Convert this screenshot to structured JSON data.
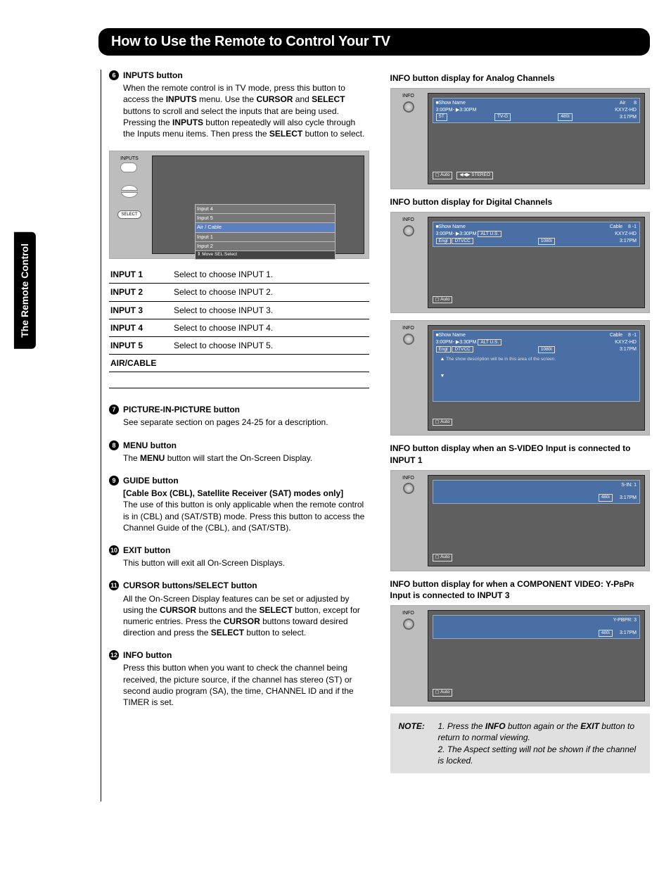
{
  "sideTab": "The Remote Control",
  "pageTitle": "How to Use the Remote to Control Your TV",
  "s6": {
    "num": "6",
    "head": "INPUTS button",
    "p1a": "When the remote control is in TV mode, press this button to access the ",
    "p1b": "INPUTS",
    "p1c": " menu. Use the ",
    "p1d": "CURSOR",
    "p1e": " and ",
    "p1f": "SELECT",
    "p1g": " buttons to scroll and select the inputs that are being used. Pressing the ",
    "p1h": "INPUTS",
    "p1i": " button repeatedly will also cycle through the Inputs menu items. Then press the ",
    "p1j": "SELECT",
    "p1k": " button to select."
  },
  "osd": {
    "inputsLbl": "INPUTS",
    "selectLbl": "SELECT",
    "items": [
      "Input 4",
      "Input 5",
      "Air / Cable",
      "Input 1",
      "Input 2"
    ],
    "footer": "⇕ Move    SEL:Select"
  },
  "inputTable": [
    [
      "INPUT 1",
      "Select to choose INPUT 1."
    ],
    [
      "INPUT 2",
      "Select to choose INPUT 2."
    ],
    [
      "INPUT 3",
      "Select to choose INPUT 3."
    ],
    [
      "INPUT 4",
      "Select to choose INPUT 4."
    ],
    [
      "INPUT 5",
      "Select to choose INPUT 5."
    ],
    [
      "AIR/CABLE",
      ""
    ]
  ],
  "s7": {
    "num": "7",
    "head": "PICTURE-IN-PICTURE button",
    "body": "See separate section on pages 24-25 for a description."
  },
  "s8": {
    "num": "8",
    "head": "MENU button",
    "b1a": "The ",
    "b1b": "MENU",
    "b1c": " button will start the On-Screen Display."
  },
  "s9": {
    "num": "9",
    "head": "GUIDE button",
    "sub": "[Cable Box (CBL), Satellite Receiver (SAT) modes only]",
    "body": "The use of this button is only applicable when the remote control is in (CBL) and (SAT/STB) mode. Press this button to access the Channel Guide of the (CBL), and (SAT/STB)."
  },
  "s10": {
    "num": "10",
    "head": "EXIT button",
    "body": "This button will exit all On-Screen Displays."
  },
  "s11": {
    "num": "11",
    "head": "CURSOR buttons/SELECT button",
    "b1a": "All the On-Screen Display features can be set or adjusted by using the ",
    "b1b": "CURSOR",
    "b1c": " buttons and the ",
    "b1d": "SELECT",
    "b1e": " button, except for numeric entries. Press the ",
    "b1f": "CURSOR",
    "b1g": " buttons toward desired direction and press the ",
    "b1h": "SELECT",
    "b1i": " button to select."
  },
  "s12": {
    "num": "12",
    "head": "INFO button",
    "body": "Press this button when you want to check the channel being received, the picture source, if the channel has stereo (ST) or second audio program (SA), the time, CHANNEL ID and if the TIMER is set."
  },
  "rh1": "INFO button display for Analog Channels",
  "analog": {
    "info": "INFO",
    "show": "■Show Name",
    "src": "Air",
    "ch": "8",
    "time": "3:00PM- ▶3:30PM",
    "call": "KXYZ-HD",
    "st": "ST",
    "rating": "TV-G",
    "res": "480i",
    "clk": "3:17PM",
    "auto": "▢ Auto",
    "stereo": "◀◀▶ STEREO"
  },
  "rh2": "INFO button display for Digital Channels",
  "dig1": {
    "info": "INFO",
    "show": "■Show Name",
    "src": "Cable",
    "ch": "8 -1",
    "time": "3:00PM- ▶3:30PM",
    "alt": "ALT U.S.",
    "call": "KXYZ-HD",
    "engl": "Engl",
    "dtvcc": "DTVCC",
    "res": "1080i",
    "clk": "3:17PM",
    "auto": "▢ Auto"
  },
  "dig2": {
    "info": "INFO",
    "show": "■Show Name",
    "src": "Cable",
    "ch": "8 -1",
    "time": "3:00PM- ▶3:30PM",
    "alt": "ALT U.S.",
    "call": "KXYZ-HD",
    "engl": "Engl",
    "dtvcc": "DTVCC",
    "res": "1080i",
    "clk": "3:17PM",
    "desc": "The show description will be in this area of the screen.",
    "up": "▲",
    "dn": "▼",
    "auto": "▢ Auto"
  },
  "rh3": "INFO button display when an S-VIDEO Input is connected to INPUT 1",
  "svid": {
    "info": "INFO",
    "label": "S-IN: 1",
    "res": "480i",
    "clk": "3:17PM",
    "auto": "▢ Auto"
  },
  "rh4a": "INFO button display for when a COMPONENT VIDEO: Y-P",
  "rh4b": "B",
  "rh4c": "P",
  "rh4d": "R",
  "rh4e": " Input is connected to INPUT 3",
  "comp": {
    "info": "INFO",
    "label": "Y-PBPR: 3",
    "res": "480i",
    "clk": "3:17PM",
    "auto": "▢ Auto"
  },
  "note": {
    "label": "NOTE:",
    "n1a": "1.   Press the ",
    "n1b": "INFO",
    "n1c": " button again or the ",
    "n1d": "EXIT",
    "n1e": " button to return to normal viewing.",
    "n2": "2.   The Aspect setting will not be shown if the channel is locked."
  }
}
